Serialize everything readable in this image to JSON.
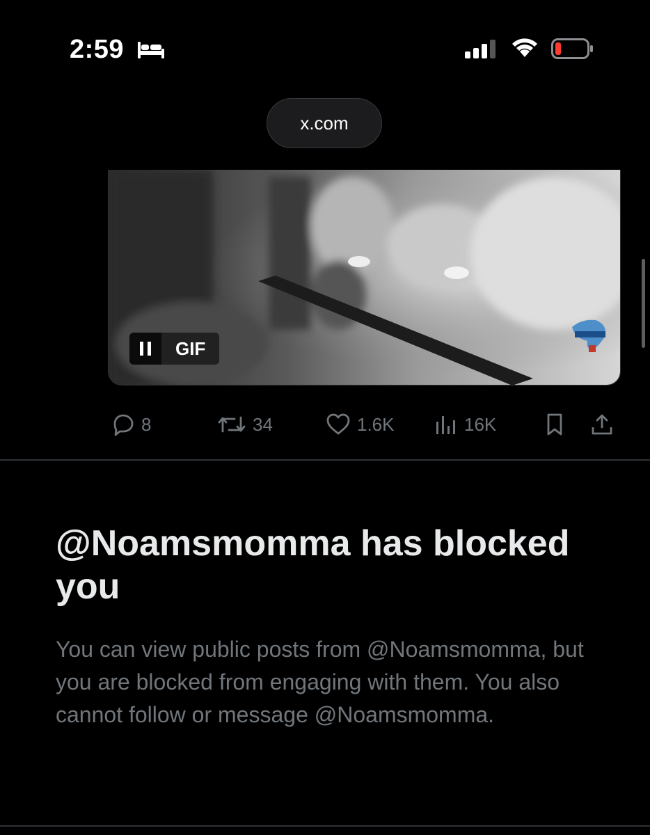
{
  "status_bar": {
    "time": "2:59",
    "focus_icon": "bed-icon",
    "signal_icon": "cellular-signal-icon",
    "wifi_icon": "wifi-icon",
    "battery_icon": "battery-low-icon",
    "battery_color": "#ff3b30"
  },
  "browser": {
    "url": "x.com"
  },
  "post": {
    "media": {
      "gif_label": "GIF",
      "pause_icon": "pause-icon",
      "watermark_icon": "enca-logo"
    },
    "actions": {
      "replies": "8",
      "reposts": "34",
      "likes": "1.6K",
      "views": "16K"
    }
  },
  "blocked_notice": {
    "title": "@Noamsmomma has blocked you",
    "body": "You can view public posts from @Noamsmomma, but you are blocked from engaging with them. You also cannot follow or message @Noamsmomma."
  },
  "colors": {
    "background": "#000000",
    "primary_text": "#e7e9ea",
    "secondary_text": "#71767b",
    "divider": "#2f3336"
  }
}
